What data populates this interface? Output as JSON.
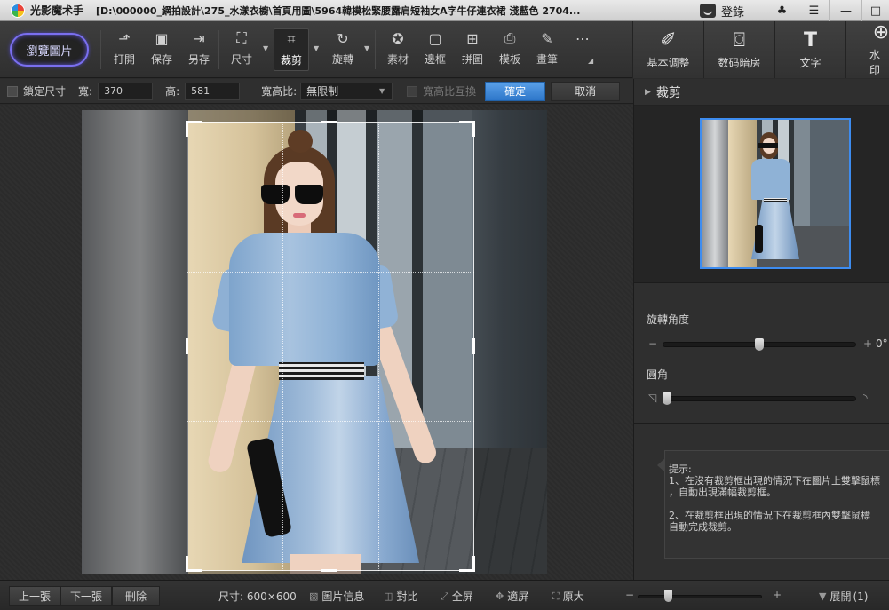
{
  "window": {
    "app_name": "光影魔术手",
    "title_path": "[D:\\000000_網拍設計\\275_水漾衣櫥\\首頁用圖\\5964韓模松緊腰露肩短袖女A字牛仔連衣裙 淺藍色 2704...",
    "login_label": "登錄"
  },
  "toolbar": {
    "browse_label": "瀏覽圖片",
    "tools": [
      {
        "label": "打開",
        "icon": "open-icon"
      },
      {
        "label": "保存",
        "icon": "save-icon"
      },
      {
        "label": "另存",
        "icon": "save-as-icon"
      },
      {
        "label": "尺寸",
        "icon": "resize-icon"
      },
      {
        "label": "裁剪",
        "icon": "crop-icon"
      },
      {
        "label": "旋轉",
        "icon": "rotate-icon"
      },
      {
        "label": "素材",
        "icon": "material-icon"
      },
      {
        "label": "邊框",
        "icon": "frame-icon"
      },
      {
        "label": "拼圖",
        "icon": "collage-icon"
      },
      {
        "label": "模板",
        "icon": "template-icon"
      },
      {
        "label": "畫筆",
        "icon": "brush-icon"
      }
    ],
    "right_tools": [
      {
        "label": "基本调整",
        "icon": "adjust-icon"
      },
      {
        "label": "数码暗房",
        "icon": "camera-icon"
      },
      {
        "label": "文字",
        "icon": "text-icon"
      },
      {
        "label": "水印",
        "icon": "watermark-icon"
      }
    ]
  },
  "crop_options": {
    "lock_size_label": "鎖定尺寸",
    "width_label": "寬:",
    "width_value": "370",
    "height_label": "高:",
    "height_value": "581",
    "ratio_label": "寬高比:",
    "ratio_value": "無限制",
    "swap_label": "寬高比互換",
    "confirm_label": "確定",
    "cancel_label": "取消"
  },
  "right_panel": {
    "section_title": "裁剪",
    "rotation_label": "旋轉角度",
    "rotation_value": "0°",
    "rotation_minus": "−",
    "rotation_plus": "+",
    "rotation_level": 0.5,
    "corner_label": "圓角",
    "corner_level": 0.0,
    "hint_lines": [
      "提示:",
      "1、在沒有裁剪框出現的情況下在圖片上雙擊鼠標",
      "，自動出現滿幅裁剪框。",
      "",
      "2、在裁剪框出現的情況下在裁剪框內雙擊鼠標",
      "自動完成裁剪。"
    ]
  },
  "statusbar": {
    "prev_label": "上一張",
    "next_label": "下一張",
    "delete_label": "刪除",
    "size_text": "尺寸: 600×600",
    "info_label": "圖片信息",
    "compare_label": "對比",
    "fullscreen_label": "全屏",
    "fit_label": "適屏",
    "original_label": "原大",
    "zoom_minus": "−",
    "zoom_plus": "+",
    "expand_label": "展開",
    "expand_count": "(1)"
  },
  "colors": {
    "accent_blue": "#3d8cf0",
    "browse_glow": "#7a6ff0",
    "panel_bg": "#2f2f2f"
  }
}
